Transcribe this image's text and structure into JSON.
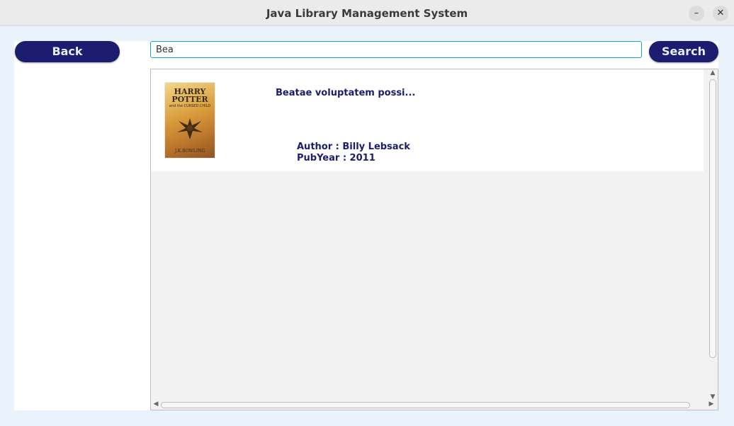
{
  "window": {
    "title": "Java Library Management System",
    "minimize_glyph": "–",
    "close_glyph": "✕"
  },
  "toolbar": {
    "back_label": "Back",
    "search_label": "Search",
    "search_value": "Bea"
  },
  "results": [
    {
      "title": "Beatae voluptatem possi...",
      "author": "Author : Billy Lebsack",
      "pub_year": "PubYear : 2011",
      "cover": {
        "title_lines": [
          "HARRY",
          "POTTER"
        ],
        "subtitle": "and the CURSED CHILD",
        "author": "J.K.ROWLING"
      }
    }
  ],
  "colors": {
    "accent": "#1c1d6e",
    "focus": "#1aa0d6"
  }
}
